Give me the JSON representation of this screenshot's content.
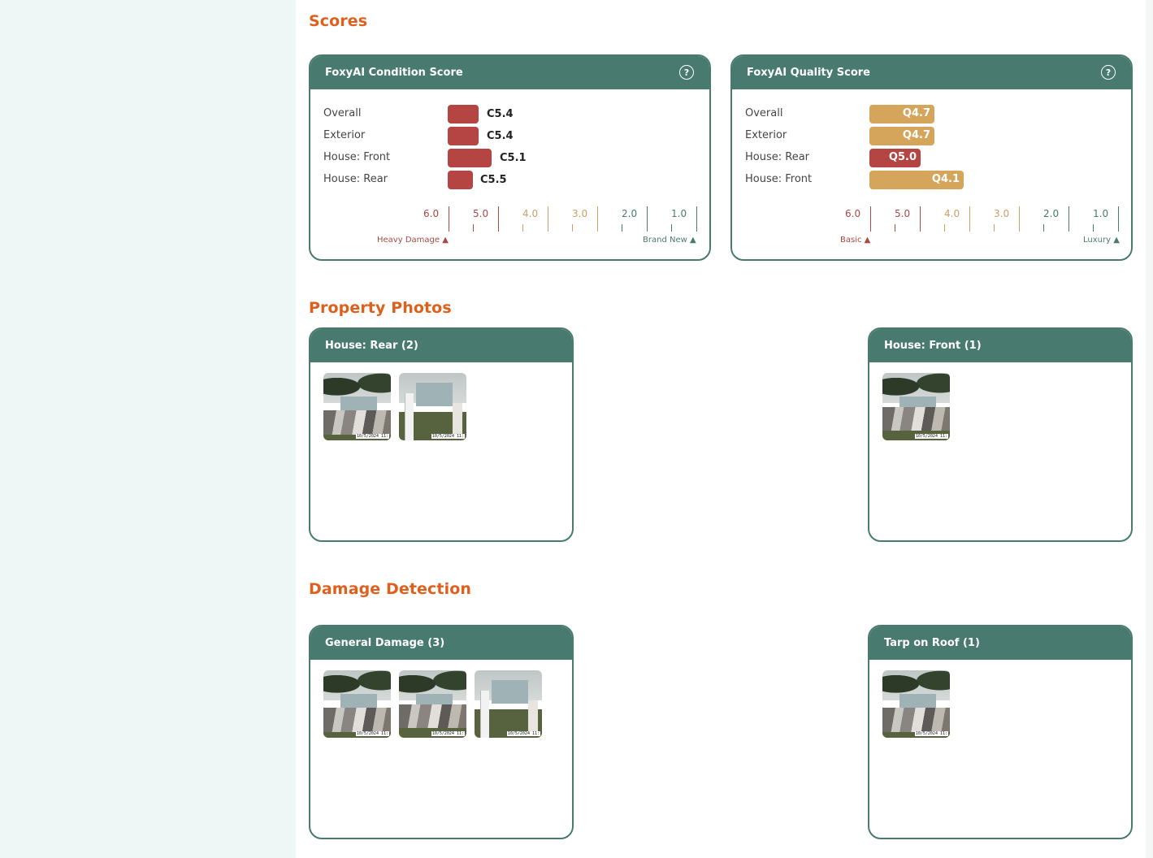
{
  "sections": {
    "scores": "Scores",
    "photos": "Property Photos",
    "damage": "Damage Detection"
  },
  "colors": {
    "teal": "#487a70",
    "orange_title": "#df5f1c",
    "condition_bar": "#b44542",
    "quality_bar_gold": "#d6a55c",
    "quality_bar_red": "#b44542"
  },
  "condition_card": {
    "title": "FoxyAI Condition Score",
    "help_icon": "question-circle-icon",
    "rows": [
      {
        "label": "Overall",
        "value": "C5.4",
        "score": 5.4
      },
      {
        "label": "Exterior",
        "value": "C5.4",
        "score": 5.4
      },
      {
        "label": "House: Front",
        "value": "C5.1",
        "score": 5.1
      },
      {
        "label": "House: Rear",
        "value": "C5.5",
        "score": 5.5
      }
    ],
    "scale_ticks": [
      "6.0",
      "5.0",
      "4.0",
      "3.0",
      "2.0",
      "1.0"
    ],
    "scale_left_note": "Heavy Damage ▲",
    "scale_right_note": "Brand New ▲"
  },
  "quality_card": {
    "title": "FoxyAI Quality Score",
    "help_icon": "question-circle-icon",
    "rows": [
      {
        "label": "Overall",
        "value": "Q4.7",
        "score": 4.7
      },
      {
        "label": "Exterior",
        "value": "Q4.7",
        "score": 4.7
      },
      {
        "label": "House: Rear",
        "value": "Q5.0",
        "score": 5.0
      },
      {
        "label": "House: Front",
        "value": "Q4.1",
        "score": 4.1
      }
    ],
    "scale_ticks": [
      "6.0",
      "5.0",
      "4.0",
      "3.0",
      "2.0",
      "1.0"
    ],
    "scale_left_note": "Basic ▲",
    "scale_right_note": "Luxury ▲"
  },
  "photo_cards": [
    {
      "title": "House: Rear (2)",
      "photos": [
        "10/5/2024 11:",
        "10/5/2024 11:"
      ]
    },
    {
      "title": "House: Front (1)",
      "photos": [
        "10/5/2024 11:"
      ]
    }
  ],
  "damage_cards": [
    {
      "title": "General Damage (3)",
      "photos": [
        "10/5/2024 11:",
        "10/5/2024 11:",
        "10/5/2024 11:"
      ]
    },
    {
      "title": "Tarp on Roof (1)",
      "photos": [
        "10/5/2024 11:"
      ]
    }
  ]
}
